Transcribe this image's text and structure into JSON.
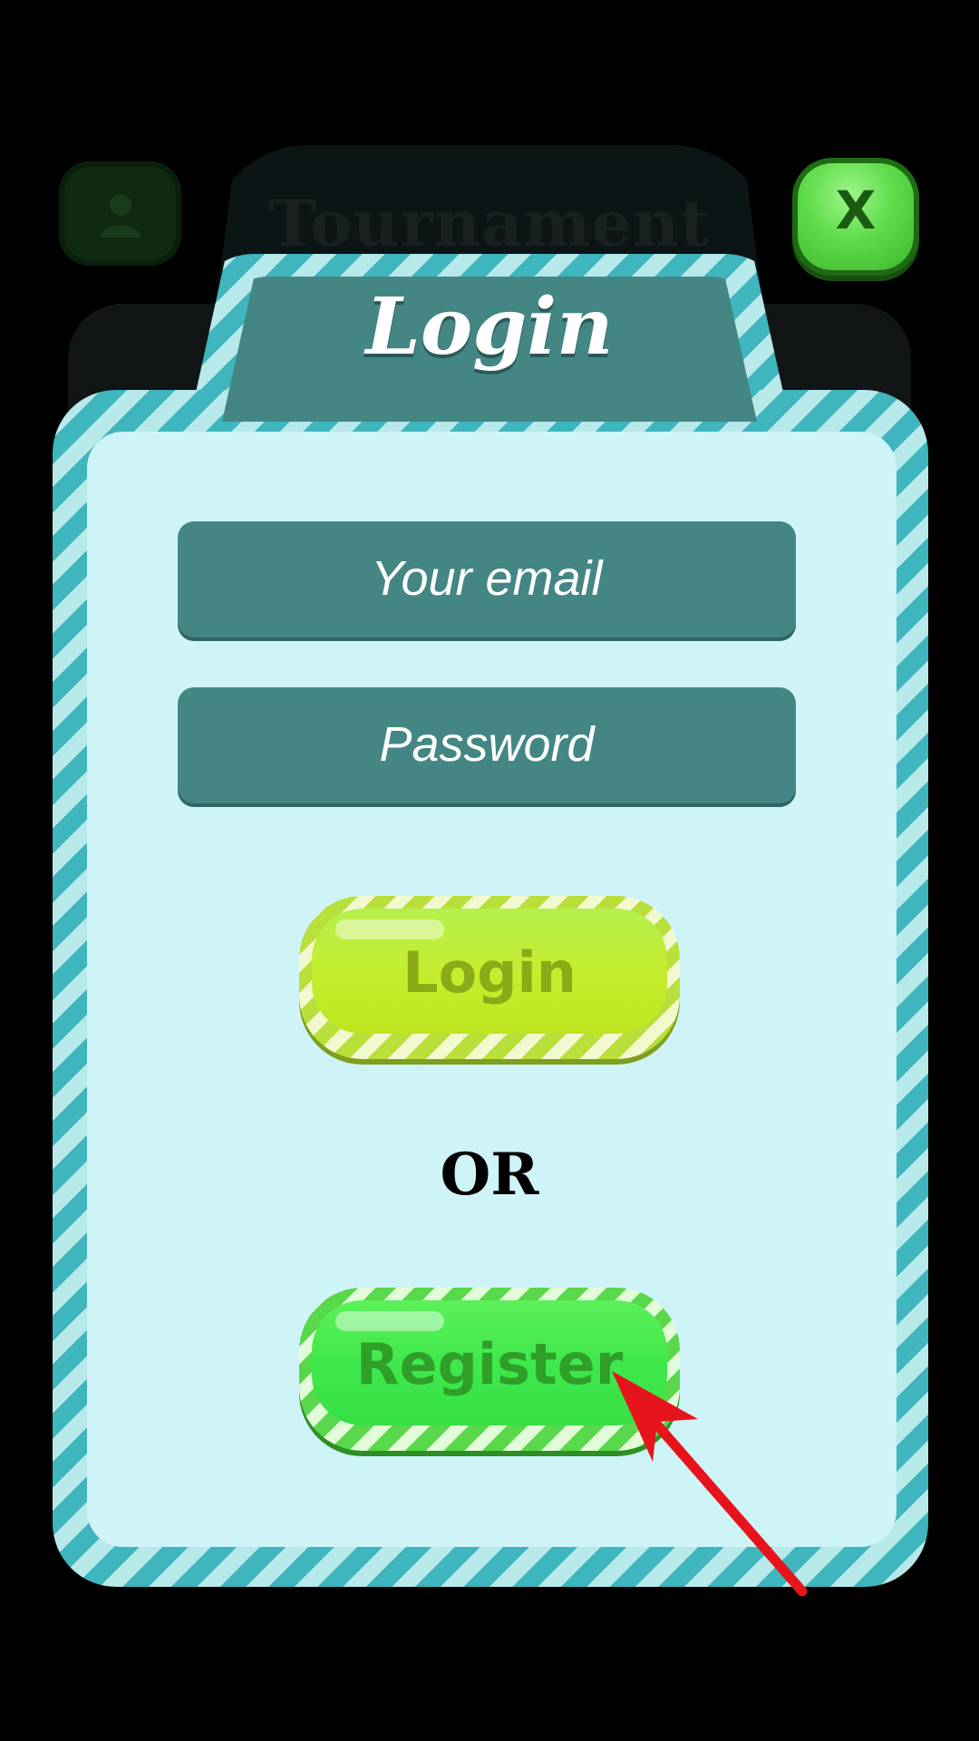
{
  "background": {
    "title": "Tournament",
    "profile_icon": "person-icon"
  },
  "close_button": {
    "label": "X",
    "icon": "close-icon"
  },
  "dialog": {
    "title": "Login",
    "email_placeholder": "Your email",
    "password_placeholder": "Password",
    "login_label": "Login",
    "or_label": "OR",
    "register_label": "Register"
  },
  "annotation": {
    "icon": "red-arrow-pointer",
    "color": "#e8141c"
  },
  "colors": {
    "stripe_dark": "#3fb5bd",
    "stripe_light": "#b7e8ea",
    "field_bg": "#438684",
    "panel_bg": "#cff4f8",
    "login_button": "#c4ed2e",
    "register_button": "#3fe84c"
  }
}
